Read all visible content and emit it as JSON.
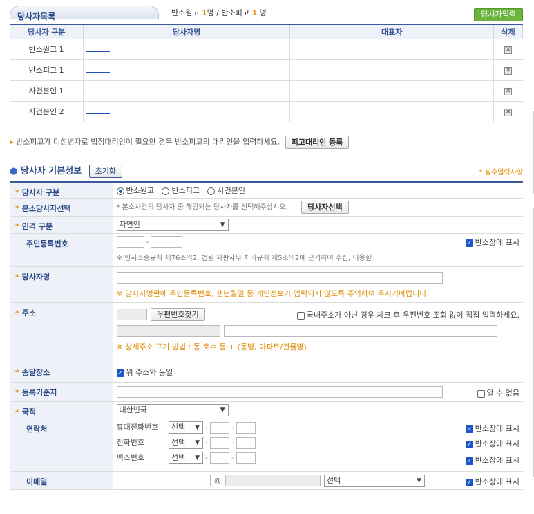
{
  "header": {
    "tab_title": "당사자목록",
    "summary_prefix": "반소원고",
    "summary_plaintiff_count": "1",
    "summary_mid": "명 / 반소피고",
    "summary_defendant_count": "1",
    "summary_suffix": " 명",
    "add_party_button": "당사자입력"
  },
  "party_table": {
    "columns": [
      "당사자 구분",
      "당사자명",
      "대표자",
      "삭제"
    ],
    "rows": [
      {
        "type": "반소원고 1"
      },
      {
        "type": "반소피고 1"
      },
      {
        "type": "사건본인 1"
      },
      {
        "type": "사건본인 2"
      }
    ],
    "delete_icon": "x-box-icon"
  },
  "note": {
    "text": "반소피고가 미성년자로 법정대리인이 필요한 경우 반소피고의 대리인을 입력하세요.",
    "button": "피고대리인 등록"
  },
  "section": {
    "title": "당사자 기본정보",
    "reset_button": "초기화",
    "required_note": "* 필수입력사항"
  },
  "form": {
    "party_type": {
      "label": "당사자 구분",
      "options": [
        "반소원고",
        "반소피고",
        "사건본인"
      ],
      "selected": "반소원고"
    },
    "main_party": {
      "label": "본소당사자선택",
      "hint": "* 본소사건의 당사자 중 해당되는 당사자를 선택해주십시오.",
      "button": "당사자선택"
    },
    "person_type": {
      "label": "인격 구분",
      "value": "자연인"
    },
    "resident_no": {
      "label": "주민등록번호",
      "show_label": "반소장에 표시",
      "note": "※ 민사소송규칙 제76조의2, 법원 재판사무 처리규칙 제5조의2에 근거하여 수집, 이용함"
    },
    "party_name": {
      "label": "당사자명",
      "warning": "※ 당사자명란에 주민등록번호, 생년월일 등 개인정보가 입력되지 않도록 주의하여 주시기바랍니다."
    },
    "address": {
      "label": "주소",
      "zip_button": "우편번호찾기",
      "foreign_label": "국내주소가 아닌 경우 체크 후 우편번호 조회 없이 직접 입력하세요.",
      "detail_note": "※ 상세주소 표기 방법 : 동 호수 등 + (동명, 아파트/건물명)"
    },
    "delivery": {
      "label": "송달장소",
      "same_label": "위 주소와 동일"
    },
    "registry": {
      "label": "등록기준지",
      "unknown_label": "알 수 없음"
    },
    "nationality": {
      "label": "국적",
      "value": "대한민국"
    },
    "contact": {
      "label": "연락처",
      "rows": [
        {
          "label": "휴대전화번호",
          "select": "선택",
          "show_label": "반소장에 표시"
        },
        {
          "label": "전화번호",
          "select": "선택",
          "show_label": "반소장에 표시"
        },
        {
          "label": "팩스번호",
          "select": "선택",
          "show_label": "반소장에 표시"
        }
      ]
    },
    "email": {
      "label": "이메일",
      "at": "@",
      "select": "선택",
      "show_label": "반소장에 표시"
    }
  }
}
